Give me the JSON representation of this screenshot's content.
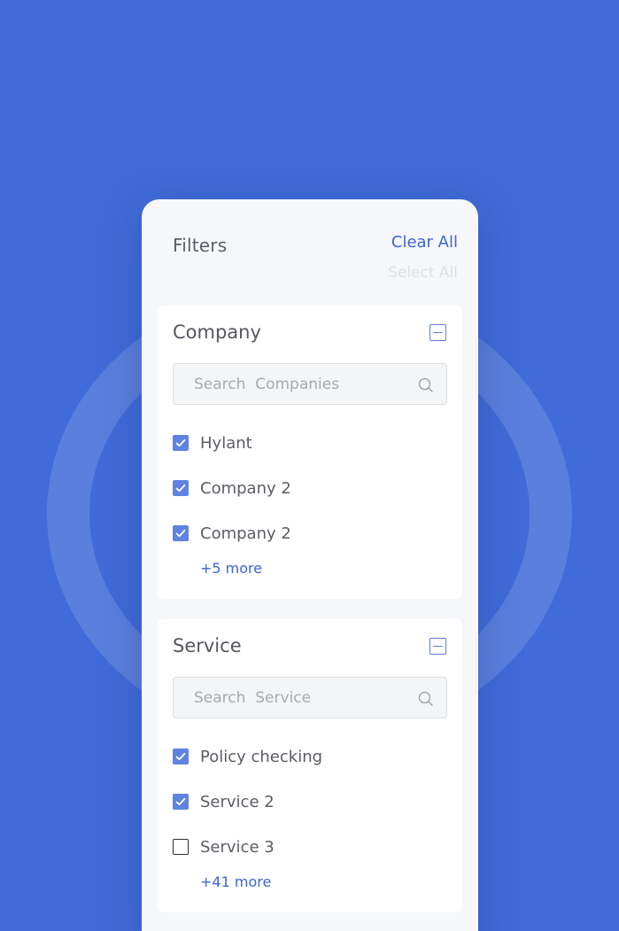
{
  "panel": {
    "title": "Filters",
    "clear_all": "Clear All",
    "select_all": "Select All"
  },
  "company": {
    "title": "Company",
    "search_placeholder": "Search  Companies",
    "items": [
      {
        "label": "Hylant",
        "checked": true
      },
      {
        "label": "Company 2",
        "checked": true
      },
      {
        "label": "Company 2",
        "checked": true
      }
    ],
    "more": "+5 more"
  },
  "service": {
    "title": "Service",
    "search_placeholder": "Search  Service",
    "items": [
      {
        "label": "Policy checking",
        "checked": true
      },
      {
        "label": "Service 2",
        "checked": true
      },
      {
        "label": "Service 3",
        "checked": false
      }
    ],
    "more": "+41 more"
  },
  "icons": {
    "search": "search-icon",
    "collapse": "minus-square-icon",
    "checkbox": "check-icon"
  },
  "colors": {
    "background": "#416bd8",
    "accent": "#3d66d2",
    "checkbox": "#5e83e0"
  }
}
